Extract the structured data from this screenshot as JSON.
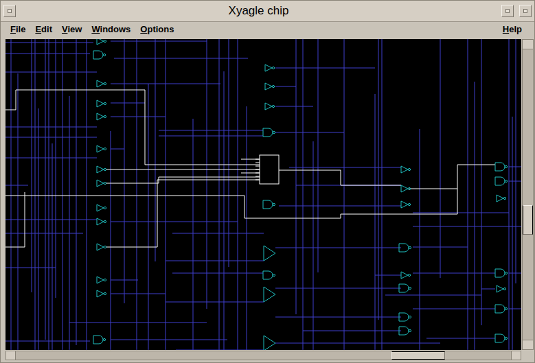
{
  "window": {
    "title": "Xyagle chip"
  },
  "menu": [
    {
      "label": "File"
    },
    {
      "label": "Edit"
    },
    {
      "label": "View"
    },
    {
      "label": "Windows"
    },
    {
      "label": "Options"
    }
  ],
  "help": "Help",
  "schematic": {
    "gates": [
      {
        "kind": "buffer"
      },
      {
        "kind": "nand"
      },
      {
        "kind": "buffer"
      },
      {
        "kind": "buffer"
      },
      {
        "kind": "buffer"
      },
      {
        "kind": "buffer"
      },
      {
        "kind": "buffer"
      },
      {
        "kind": "buffer"
      },
      {
        "kind": "buffer"
      },
      {
        "kind": "buffer"
      },
      {
        "kind": "buffer"
      },
      {
        "kind": "buffer"
      },
      {
        "kind": "buffer"
      },
      {
        "kind": "nand"
      },
      {
        "kind": "buffer"
      },
      {
        "kind": "buffer"
      },
      {
        "kind": "buffer"
      },
      {
        "kind": "nand"
      },
      {
        "kind": "block"
      },
      {
        "kind": "nand"
      },
      {
        "kind": "amp"
      },
      {
        "kind": "nand"
      },
      {
        "kind": "amp"
      },
      {
        "kind": "amp"
      },
      {
        "kind": "buffer"
      },
      {
        "kind": "buffer"
      },
      {
        "kind": "buffer"
      },
      {
        "kind": "nand"
      },
      {
        "kind": "buffer"
      },
      {
        "kind": "nand"
      },
      {
        "kind": "nand"
      },
      {
        "kind": "nand"
      },
      {
        "kind": "nand"
      },
      {
        "kind": "nand"
      },
      {
        "kind": "buffer"
      },
      {
        "kind": "nand"
      },
      {
        "kind": "buffer"
      },
      {
        "kind": "nand"
      },
      {
        "kind": "nand"
      }
    ],
    "selected_net": {
      "highlighted": true
    }
  },
  "scrollbars": {
    "vertical": {
      "level": 0.6
    },
    "horizontal": {
      "level": 0.85
    }
  }
}
